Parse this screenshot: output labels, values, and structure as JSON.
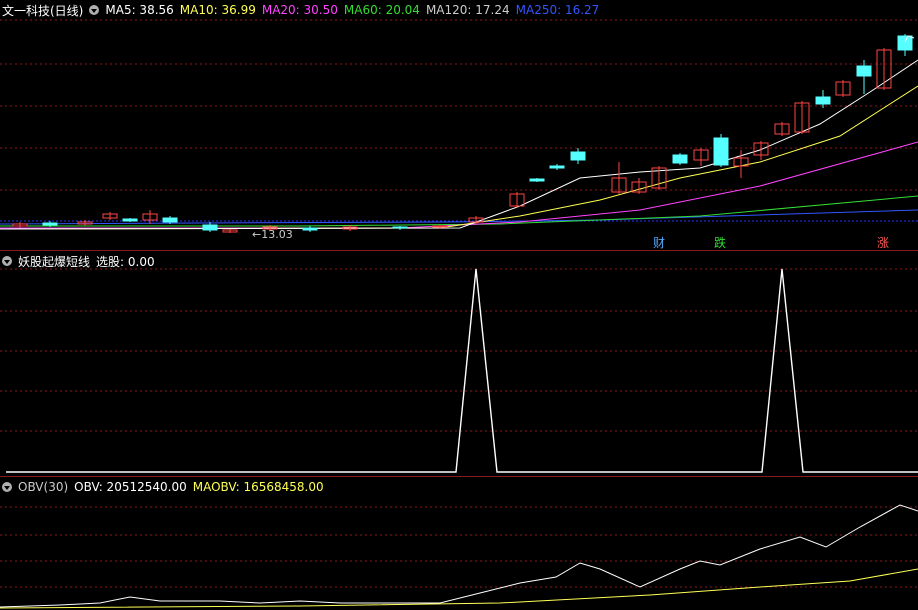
{
  "main_panel": {
    "stock_title": "文一科技(日线)",
    "ma": [
      {
        "label": "MA5: 38.56",
        "color": "#ffffff"
      },
      {
        "label": "MA10: 36.99",
        "color": "#ffff55"
      },
      {
        "label": "MA20: 30.50",
        "color": "#ff44ff"
      },
      {
        "label": "MA60: 20.04",
        "color": "#33dd33"
      },
      {
        "label": "MA120: 17.24",
        "color": "#cccccc"
      },
      {
        "label": "MA250: 16.27",
        "color": "#3355ff"
      }
    ],
    "low_price_label": "←13.03",
    "event_tags": [
      {
        "text": "财",
        "color": "#55aaff"
      },
      {
        "text": "跌",
        "color": "#33dd33"
      },
      {
        "text": "涨",
        "color": "#ff5555"
      }
    ]
  },
  "indicator_panel": {
    "title": "妖股起爆短线",
    "value": "选股: 0.00"
  },
  "obv_panel": {
    "title": "OBV(30)",
    "obv": "OBV: 20512540.00",
    "maobv": "MAOBV: 16568458.00",
    "obv_color": "#ffffff",
    "maobv_color": "#ffff55"
  },
  "colors": {
    "up_candle": "#ff4444",
    "down_candle": "#55ffff",
    "grid": "#8a1a1a"
  }
}
